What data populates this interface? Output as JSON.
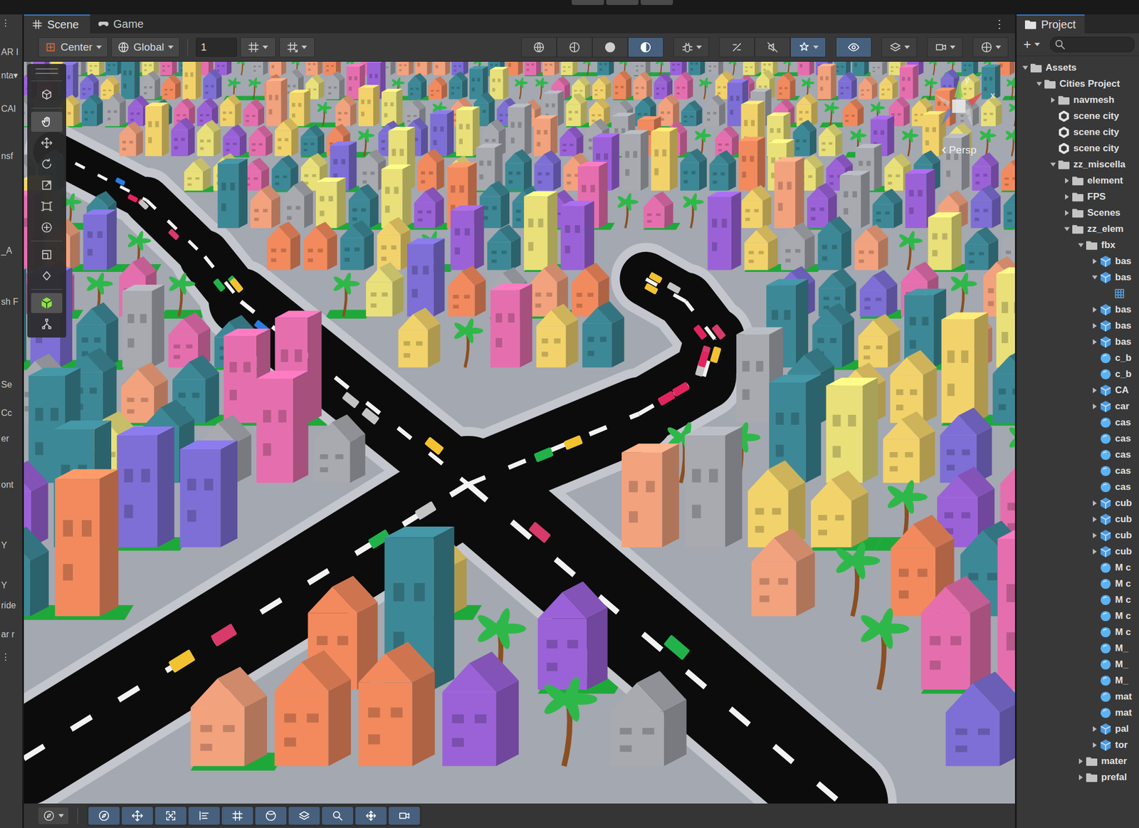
{
  "inspector": {
    "fragments": [
      "⋮",
      "AR I",
      "nta▾",
      "CAI",
      "nsf",
      "_A",
      "sh F",
      "Se",
      "Cc",
      "er",
      "ont",
      "Y",
      "Y",
      "ride",
      "ar r",
      "⋮"
    ]
  },
  "scene_tabs": [
    {
      "label": "Scene",
      "selected": true,
      "kind": "scene"
    },
    {
      "label": "Game",
      "selected": false,
      "kind": "game"
    }
  ],
  "scene_menu": "⋮",
  "toolbar": {
    "pivot": "Center",
    "space": "Global",
    "grid_size": "1",
    "snap_buttons": [
      {
        "kind": "grid-snap",
        "on": false
      },
      {
        "kind": "increment-snap",
        "on": false
      }
    ],
    "view_groups": [
      [
        {
          "kind": "globe",
          "on": false,
          "dropdown": false
        },
        {
          "kind": "half-sphere",
          "on": false,
          "dropdown": false
        },
        {
          "kind": "sphere",
          "on": false,
          "dropdown": false
        },
        {
          "kind": "moon",
          "on": true,
          "dropdown": false
        }
      ],
      [
        {
          "kind": "bug",
          "on": false,
          "dropdown": true
        }
      ],
      [
        {
          "kind": "slash-2d",
          "on": false,
          "dropdown": false
        },
        {
          "kind": "mute",
          "on": false,
          "dropdown": false
        },
        {
          "kind": "fx",
          "on": true,
          "dropdown": true
        }
      ],
      [
        {
          "kind": "eye",
          "on": true,
          "dropdown": false
        }
      ],
      [
        {
          "kind": "layers",
          "on": false,
          "dropdown": true
        }
      ],
      [
        {
          "kind": "camera",
          "on": false,
          "dropdown": true
        }
      ],
      [
        {
          "kind": "gizmo",
          "on": false,
          "dropdown": true
        }
      ]
    ]
  },
  "tool_palette": [
    {
      "tools": [
        {
          "kind": "context",
          "selected": false
        }
      ]
    },
    {
      "tools": [
        {
          "kind": "hand",
          "selected": true
        },
        {
          "kind": "move",
          "selected": false
        },
        {
          "kind": "rotate",
          "selected": false
        },
        {
          "kind": "scale",
          "selected": false
        },
        {
          "kind": "rect",
          "selected": false
        },
        {
          "kind": "transform",
          "selected": false
        }
      ]
    },
    {
      "tools": [
        {
          "kind": "view",
          "selected": false
        },
        {
          "kind": "custom",
          "selected": false
        }
      ]
    },
    {
      "tools": [
        {
          "kind": "cube",
          "selected": true
        },
        {
          "kind": "nodes",
          "selected": false
        }
      ]
    }
  ],
  "viewport": {
    "camera": "Persp",
    "axes": [
      "y",
      "x"
    ]
  },
  "bottom_toolbar": {
    "dropdown": {
      "kind": "compass"
    },
    "buttons": [
      {
        "kind": "compass",
        "on": true
      },
      {
        "kind": "move",
        "on": true
      },
      {
        "kind": "frame",
        "on": true
      },
      {
        "kind": "align",
        "on": true
      },
      {
        "kind": "grid-snap",
        "on": true
      },
      {
        "kind": "sphere-outline",
        "on": true
      },
      {
        "kind": "layers",
        "on": true
      },
      {
        "kind": "search",
        "on": true
      },
      {
        "kind": "pivot-move",
        "on": true
      },
      {
        "kind": "camera",
        "on": true
      }
    ]
  },
  "project": {
    "tab": "Project",
    "add": "+",
    "tree": [
      {
        "label": "Assets",
        "depth": 0,
        "kind": "folder",
        "expandable": true,
        "expanded": true
      },
      {
        "label": "Cities Project",
        "depth": 1,
        "kind": "folder",
        "expandable": true,
        "expanded": true
      },
      {
        "label": "navmesh",
        "depth": 2,
        "kind": "folder",
        "expandable": true,
        "expanded": false
      },
      {
        "label": "scene city",
        "depth": 2,
        "kind": "scene",
        "expandable": false,
        "expanded": false
      },
      {
        "label": "scene city",
        "depth": 2,
        "kind": "scene",
        "expandable": false,
        "expanded": false
      },
      {
        "label": "scene city",
        "depth": 2,
        "kind": "scene",
        "expandable": false,
        "expanded": false
      },
      {
        "label": "zz_miscella",
        "depth": 2,
        "kind": "folder",
        "expandable": true,
        "expanded": true
      },
      {
        "label": "element",
        "depth": 3,
        "kind": "folder",
        "expandable": true,
        "expanded": false
      },
      {
        "label": "FPS",
        "depth": 3,
        "kind": "folder",
        "expandable": true,
        "expanded": false
      },
      {
        "label": "Scenes",
        "depth": 3,
        "kind": "folder",
        "expandable": true,
        "expanded": false
      },
      {
        "label": "zz_elem",
        "depth": 3,
        "kind": "folder",
        "expandable": true,
        "expanded": true
      },
      {
        "label": "fbx",
        "depth": 4,
        "kind": "folder",
        "expandable": true,
        "expanded": true
      },
      {
        "label": "bas",
        "depth": 5,
        "kind": "model",
        "expandable": true,
        "expanded": false
      },
      {
        "label": "bas",
        "depth": 5,
        "kind": "model",
        "expandable": true,
        "expanded": true
      },
      {
        "label": "",
        "depth": 6,
        "kind": "mesh",
        "expandable": false,
        "expanded": false
      },
      {
        "label": "bas",
        "depth": 5,
        "kind": "model",
        "expandable": true,
        "expanded": false
      },
      {
        "label": "bas",
        "depth": 5,
        "kind": "model",
        "expandable": true,
        "expanded": false
      },
      {
        "label": "bas",
        "depth": 5,
        "kind": "model",
        "expandable": true,
        "expanded": false
      },
      {
        "label": "c_b",
        "depth": 5,
        "kind": "material",
        "expandable": false,
        "expanded": false
      },
      {
        "label": "c_b",
        "depth": 5,
        "kind": "material",
        "expandable": false,
        "expanded": false
      },
      {
        "label": "CA",
        "depth": 5,
        "kind": "model",
        "expandable": true,
        "expanded": false
      },
      {
        "label": "car",
        "depth": 5,
        "kind": "model",
        "expandable": true,
        "expanded": false
      },
      {
        "label": "cas",
        "depth": 5,
        "kind": "material",
        "expandable": false,
        "expanded": false
      },
      {
        "label": "cas",
        "depth": 5,
        "kind": "material",
        "expandable": false,
        "expanded": false
      },
      {
        "label": "cas",
        "depth": 5,
        "kind": "material",
        "expandable": false,
        "expanded": false
      },
      {
        "label": "cas",
        "depth": 5,
        "kind": "material",
        "expandable": false,
        "expanded": false
      },
      {
        "label": "cas",
        "depth": 5,
        "kind": "material",
        "expandable": false,
        "expanded": false
      },
      {
        "label": "cub",
        "depth": 5,
        "kind": "model",
        "expandable": true,
        "expanded": false
      },
      {
        "label": "cub",
        "depth": 5,
        "kind": "model",
        "expandable": true,
        "expanded": false
      },
      {
        "label": "cub",
        "depth": 5,
        "kind": "model",
        "expandable": true,
        "expanded": false
      },
      {
        "label": "cub",
        "depth": 5,
        "kind": "model",
        "expandable": true,
        "expanded": false
      },
      {
        "label": "M c",
        "depth": 5,
        "kind": "material",
        "expandable": false,
        "expanded": false
      },
      {
        "label": "M c",
        "depth": 5,
        "kind": "material",
        "expandable": false,
        "expanded": false
      },
      {
        "label": "M c",
        "depth": 5,
        "kind": "material",
        "expandable": false,
        "expanded": false
      },
      {
        "label": "M c",
        "depth": 5,
        "kind": "material",
        "expandable": false,
        "expanded": false
      },
      {
        "label": "M c",
        "depth": 5,
        "kind": "material",
        "expandable": false,
        "expanded": false
      },
      {
        "label": "M_",
        "depth": 5,
        "kind": "material",
        "expandable": false,
        "expanded": false
      },
      {
        "label": "M_",
        "depth": 5,
        "kind": "material",
        "expandable": false,
        "expanded": false
      },
      {
        "label": "M_",
        "depth": 5,
        "kind": "material",
        "expandable": false,
        "expanded": false
      },
      {
        "label": "mat",
        "depth": 5,
        "kind": "material",
        "expandable": false,
        "expanded": false
      },
      {
        "label": "mat",
        "depth": 5,
        "kind": "material",
        "expandable": false,
        "expanded": false
      },
      {
        "label": "pal",
        "depth": 5,
        "kind": "model",
        "expandable": true,
        "expanded": false
      },
      {
        "label": "tor",
        "depth": 5,
        "kind": "model",
        "expandable": true,
        "expanded": false
      },
      {
        "label": "mater",
        "depth": 4,
        "kind": "folder",
        "expandable": true,
        "expanded": false
      },
      {
        "label": "prefal",
        "depth": 4,
        "kind": "folder",
        "expandable": true,
        "expanded": false
      }
    ]
  }
}
